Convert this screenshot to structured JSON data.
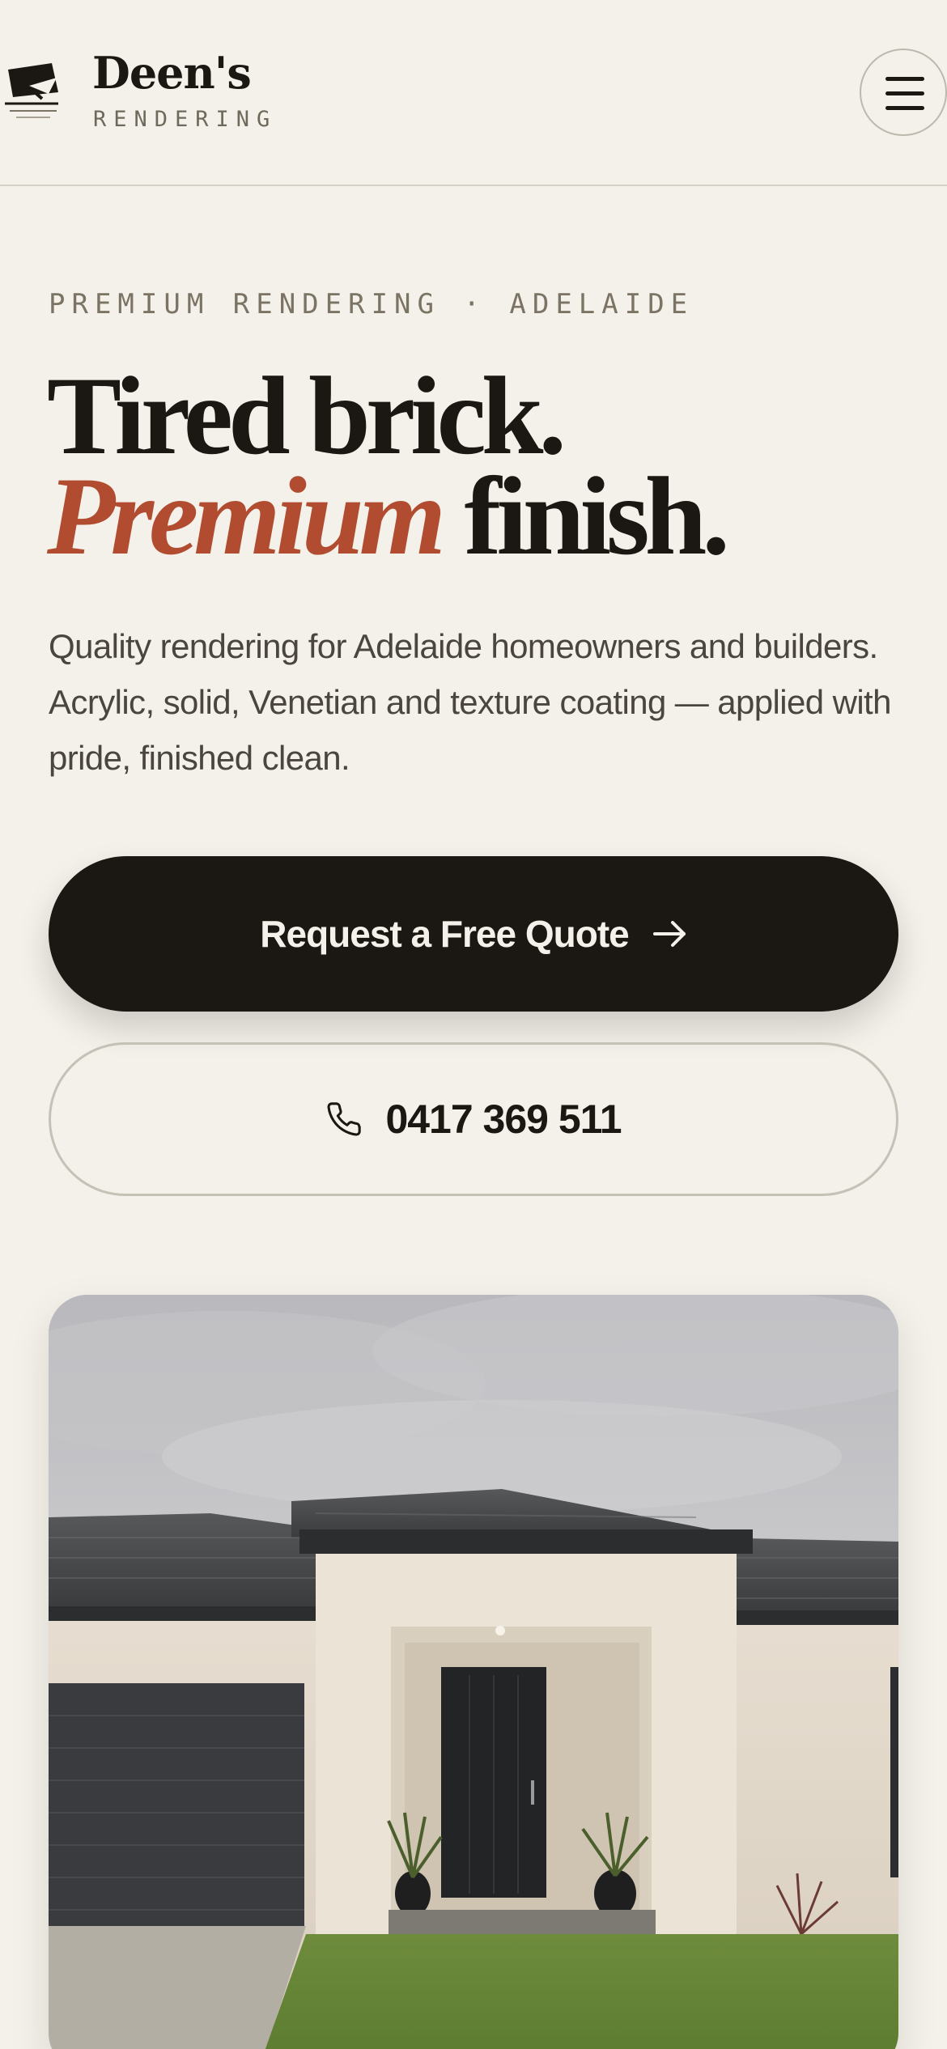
{
  "header": {
    "brand_name": "Deen's",
    "brand_sub": "RENDERING",
    "logo_icon": "trowel-icon",
    "menu_icon": "hamburger-menu-icon"
  },
  "hero": {
    "eyebrow": "PREMIUM RENDERING · ADELAIDE",
    "headline_line1": "Tired brick.",
    "headline_accent": "Premium",
    "headline_line2_rest": "finish.",
    "lede": "Quality rendering for Adelaide homeowners and builders. Acrylic, solid, Venetian and texture coating — applied with pride, finished clean.",
    "cta_primary": "Request a Free Quote",
    "cta_primary_icon": "arrow-right-icon",
    "cta_secondary": "0417 369 511",
    "cta_secondary_icon": "phone-icon",
    "image_subject": "rendered-house-photo"
  },
  "colors": {
    "background": "#f4f1ea",
    "ink": "#1b1814",
    "accent": "#b24c30",
    "muted": "#7b7464"
  }
}
